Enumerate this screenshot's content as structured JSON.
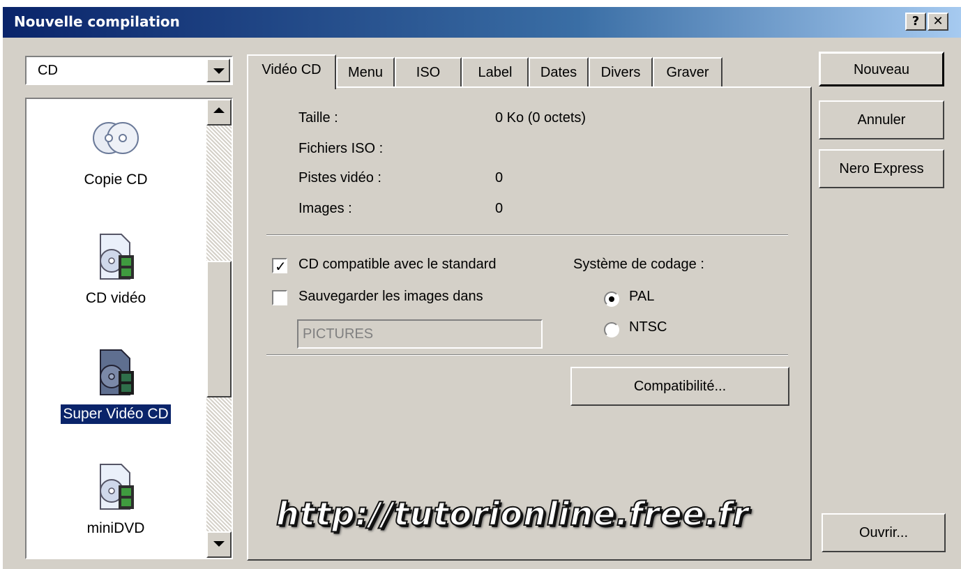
{
  "window": {
    "title": "Nouvelle compilation",
    "help_btn": "?",
    "close_btn": "✕"
  },
  "left": {
    "type_select": {
      "value": "CD"
    },
    "items": [
      {
        "label": "Copie CD",
        "icon": "copy-cd-icon",
        "selected": false
      },
      {
        "label": "CD vidéo",
        "icon": "video-cd-icon",
        "selected": false
      },
      {
        "label": "Super Vidéo CD",
        "icon": "super-video-cd-icon",
        "selected": true
      },
      {
        "label": "miniDVD",
        "icon": "minidvd-icon",
        "selected": false
      }
    ]
  },
  "tabs": [
    "Vidéo CD",
    "Menu",
    "ISO",
    "Label",
    "Dates",
    "Divers",
    "Graver"
  ],
  "active_tab": "Vidéo CD",
  "info": {
    "size_label": "Taille :",
    "size_value": "0 Ko (0 octets)",
    "iso_label": "Fichiers ISO :",
    "tracks_label": "Pistes vidéo :",
    "tracks_value": "0",
    "images_label": "Images :",
    "images_value": "0"
  },
  "options": {
    "standard_label": "CD compatible avec le standard",
    "standard_checked": true,
    "save_images_label": "Sauvegarder les images dans",
    "save_images_checked": false,
    "folder_value": "PICTURES"
  },
  "encoding": {
    "label": "Système de codage :",
    "options": [
      "PAL",
      "NTSC"
    ],
    "selected": "PAL"
  },
  "buttons": {
    "compat": "Compatibilité...",
    "new": "Nouveau",
    "cancel": "Annuler",
    "express": "Nero Express",
    "open": "Ouvrir..."
  },
  "watermark": "http://tutorionline.free.fr"
}
